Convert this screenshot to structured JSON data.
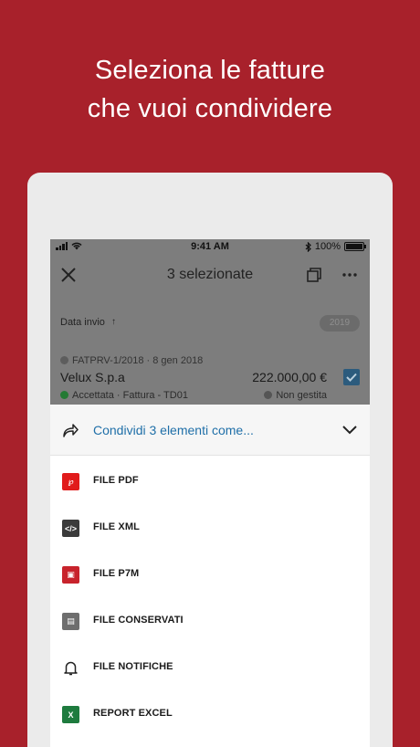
{
  "headline": {
    "line1": "Seleziona le fatture",
    "line2": "che vuoi condividere"
  },
  "status_bar": {
    "time": "9:41 AM",
    "battery": "100%",
    "battery_level": 1.0
  },
  "nav": {
    "title": "3 selezionate",
    "close_icon": "close-icon",
    "copy_icon": "copy-icon",
    "more_icon": "more-icon"
  },
  "sort": {
    "label": "Data invio",
    "direction": "↑",
    "year": "2019"
  },
  "invoice": {
    "code": "FATPRV-1/2018 · 8 gen 2018",
    "company": "Velux S.p.a",
    "amount": "222.000,00 €",
    "status": "Accettata · Fattura - TD01",
    "management": "Non gestita",
    "selected": true
  },
  "share": {
    "label": "Condividi 3 elementi come...",
    "options": [
      {
        "label": "FILE PDF",
        "icon": "pdf-icon",
        "color": "#e11b1b",
        "glyph": "℘"
      },
      {
        "label": "FILE XML",
        "icon": "xml-icon",
        "color": "#3b3b3b",
        "glyph": "</>"
      },
      {
        "label": "FILE P7M",
        "icon": "p7m-icon",
        "color": "#c8232c",
        "glyph": "▣"
      },
      {
        "label": "FILE CONSERVATI",
        "icon": "archive-icon",
        "color": "#6e6e6e",
        "glyph": "▤"
      },
      {
        "label": "FILE NOTIFICHE",
        "icon": "bell-icon",
        "color": "#ffffff",
        "glyph": ""
      },
      {
        "label": "REPORT EXCEL",
        "icon": "excel-icon",
        "color": "#1e7b3e",
        "glyph": "X"
      }
    ]
  },
  "colors": {
    "background": "#a8212b",
    "accent_blue": "#1f6fa8",
    "dim_overlay": "#7d7d7d"
  }
}
